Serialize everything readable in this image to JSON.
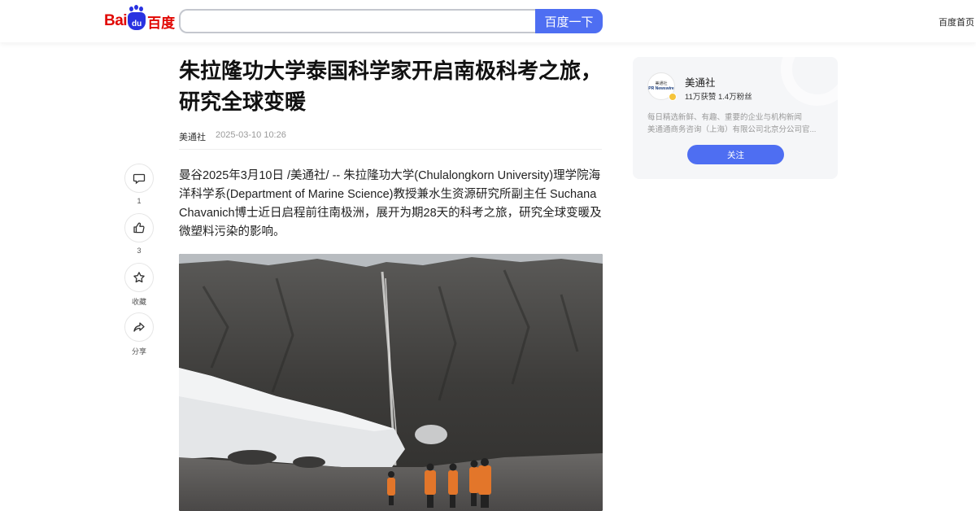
{
  "header": {
    "logo": {
      "latin": "Bai",
      "paw_text": "du",
      "cn": "百度"
    },
    "search": {
      "value": "",
      "placeholder": ""
    },
    "search_button": "百度一下",
    "home_link": "百度首页"
  },
  "article": {
    "title": "朱拉隆功大学泰国科学家开启南极科考之旅，研究全球变暖",
    "source": "美通社",
    "date": "2025-03-10 10:26",
    "body": "曼谷2025年3月10日 /美通社/ -- 朱拉隆功大学(Chulalongkorn University)理学院海洋科学系(Department of Marine Science)教授兼水生资源研究所副主任 Suchana Chavanich博士近日启程前往南极洲，展开为期28天的科考之旅，研究全球变暖及微塑料污染的影响。"
  },
  "rail": {
    "comment": {
      "icon": "comment-icon",
      "label": "1"
    },
    "like": {
      "icon": "thumbs-up-icon",
      "label": "3"
    },
    "favorite": {
      "icon": "star-icon",
      "label": "收藏"
    },
    "share": {
      "icon": "share-icon",
      "label": "分享"
    }
  },
  "author_card": {
    "avatar_line1": "美通社",
    "avatar_line2": "PR Newswire",
    "name": "美通社",
    "stats": "11万获赞 1.4万粉丝",
    "desc_line1": "每日精选新鲜、有趣、重要的企业与机构新闻",
    "desc_line2": "美通通商务咨询（上海）有限公司北京分公司官...",
    "follow_button": "关注"
  },
  "colors": {
    "accent": "#4e6ef2",
    "logo_red": "#e10601",
    "logo_blue": "#2932e1",
    "verified_badge": "#f5c43b"
  }
}
